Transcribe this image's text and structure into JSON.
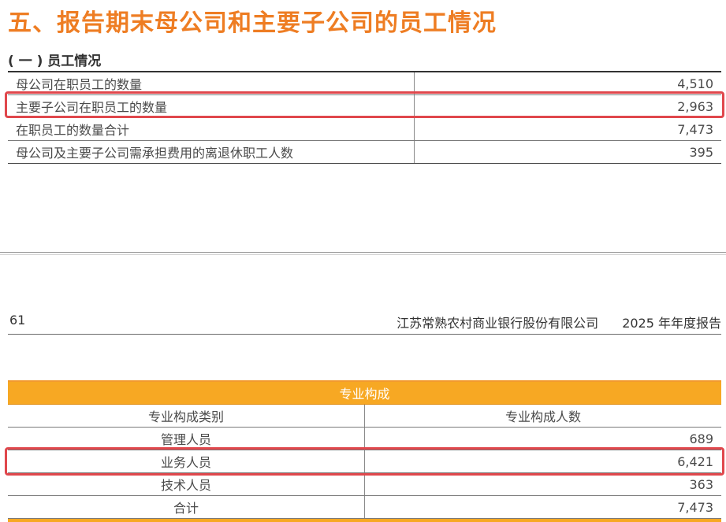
{
  "section": {
    "title": "五、报告期末母公司和主要子公司的员工情况"
  },
  "subsection": {
    "title": "( 一 ) 员工情况"
  },
  "employee_table": {
    "rows": [
      {
        "label": "母公司在职员工的数量",
        "value": "4,510"
      },
      {
        "label": "主要子公司在职员工的数量",
        "value": "2,963"
      },
      {
        "label": "在职员工的数量合计",
        "value": "7,473"
      },
      {
        "label": "母公司及主要子公司需承担费用的离退休职工人数",
        "value": "395"
      }
    ]
  },
  "footer": {
    "page_number": "61",
    "company": "江苏常熟农村商业银行股份有限公司",
    "report": "2025 年年度报告"
  },
  "professional_table": {
    "title": "专业构成",
    "headers": [
      "专业构成类别",
      "专业构成人数"
    ],
    "rows": [
      {
        "label": "管理人员",
        "value": "689"
      },
      {
        "label": "业务人员",
        "value": "6,421"
      },
      {
        "label": "技术人员",
        "value": "363"
      },
      {
        "label": "合计",
        "value": "7,473"
      }
    ]
  },
  "colors": {
    "accent": "#ee7d23",
    "band": "#f7a823",
    "highlight": "#e0474c"
  }
}
